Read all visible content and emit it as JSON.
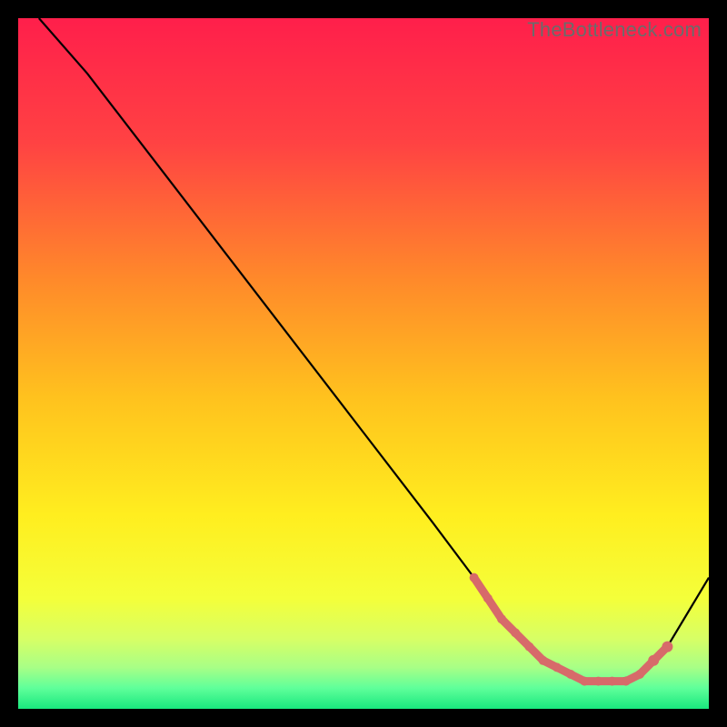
{
  "watermark": "TheBottleneck.com",
  "chart_data": {
    "type": "line",
    "title": "",
    "xlabel": "",
    "ylabel": "",
    "xlim": [
      0,
      100
    ],
    "ylim": [
      0,
      100
    ],
    "grid": false,
    "legend": false,
    "series": [
      {
        "name": "curve",
        "x": [
          3,
          10,
          20,
          30,
          40,
          50,
          60,
          66,
          70,
          74,
          78,
          82,
          86,
          90,
          94,
          100
        ],
        "y": [
          100,
          92,
          79,
          66,
          53,
          40,
          27,
          19,
          13,
          9,
          6,
          4,
          4,
          5,
          9,
          19
        ]
      }
    ],
    "highlight_points": {
      "name": "flat-region",
      "color": "#d76a6a",
      "x": [
        66,
        68,
        70,
        72,
        74,
        76,
        78,
        80,
        82,
        84,
        86,
        88,
        90,
        92,
        94
      ],
      "y": [
        19,
        16,
        13,
        11,
        9,
        7,
        6,
        5,
        4,
        4,
        4,
        4,
        5,
        7,
        9
      ]
    },
    "background_gradient": {
      "stops": [
        {
          "offset": 0.0,
          "color": "#ff1f4b"
        },
        {
          "offset": 0.18,
          "color": "#ff4243"
        },
        {
          "offset": 0.38,
          "color": "#ff8a2a"
        },
        {
          "offset": 0.55,
          "color": "#ffc21e"
        },
        {
          "offset": 0.72,
          "color": "#ffee1f"
        },
        {
          "offset": 0.84,
          "color": "#f4ff3a"
        },
        {
          "offset": 0.9,
          "color": "#d6ff66"
        },
        {
          "offset": 0.94,
          "color": "#a8ff86"
        },
        {
          "offset": 0.97,
          "color": "#5fff9a"
        },
        {
          "offset": 1.0,
          "color": "#19e87e"
        }
      ]
    }
  }
}
